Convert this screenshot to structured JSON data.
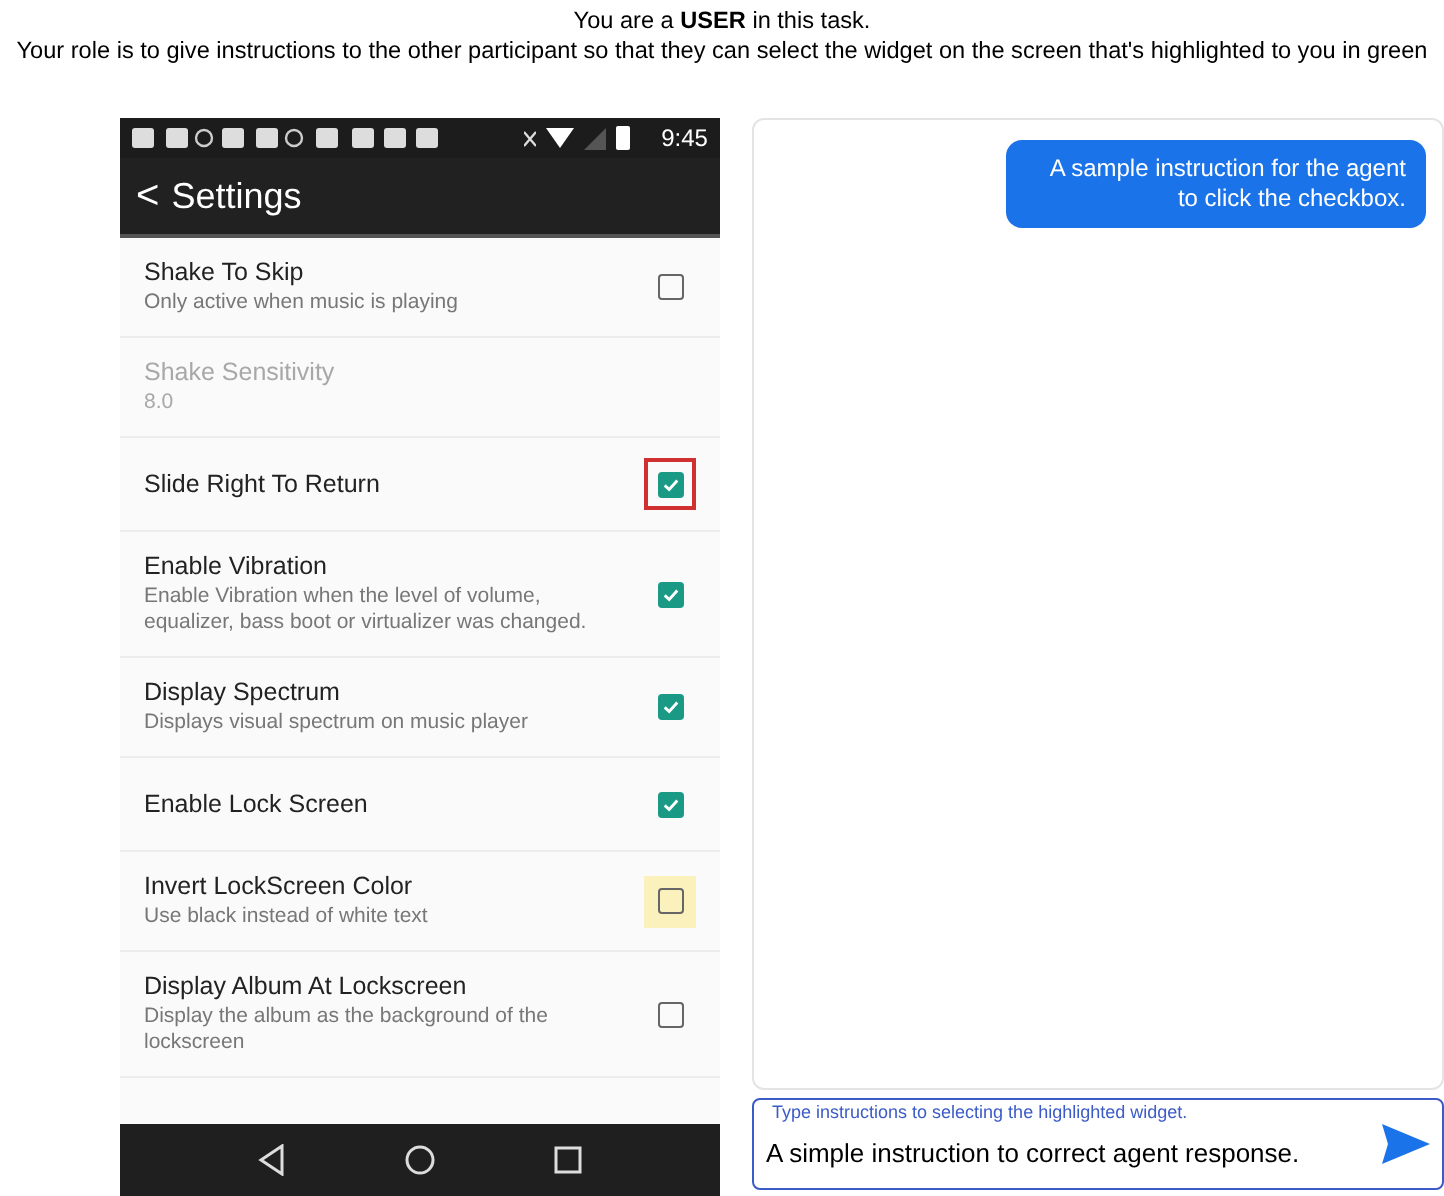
{
  "header": {
    "line1": "You are a **USER** in this task.",
    "line2": "Your role is to give instructions to the other participant so that they can select the widget on the screen that's highlighted to you in green"
  },
  "phone": {
    "time": "9:45",
    "app_bar": {
      "back": "<",
      "title": "Settings"
    },
    "settings": [
      {
        "kind": "checkbox",
        "title": "Shake To Skip",
        "subtitle": "Only active when music is playing",
        "checked": false,
        "disabled": false,
        "outlined": false,
        "highlighted": false
      },
      {
        "kind": "value",
        "title": "Shake Sensitivity",
        "subtitle": "8.0",
        "disabled": true
      },
      {
        "kind": "checkbox",
        "title": "Slide Right To Return",
        "checked": true,
        "disabled": false,
        "outlined": true,
        "highlighted": false
      },
      {
        "kind": "checkbox",
        "title": "Enable Vibration",
        "subtitle": "Enable Vibration when the level of volume, equalizer, bass boot or virtualizer was changed.",
        "checked": true,
        "disabled": false,
        "outlined": false,
        "highlighted": false
      },
      {
        "kind": "checkbox",
        "title": "Display Spectrum",
        "subtitle": "Displays visual spectrum on music player",
        "checked": true,
        "disabled": false,
        "outlined": false,
        "highlighted": false
      },
      {
        "kind": "checkbox",
        "title": "Enable Lock Screen",
        "checked": true,
        "disabled": false,
        "outlined": false,
        "highlighted": false
      },
      {
        "kind": "checkbox",
        "title": "Invert LockScreen Color",
        "subtitle": "Use black instead of white text",
        "checked": false,
        "disabled": false,
        "outlined": false,
        "highlighted": true
      },
      {
        "kind": "checkbox",
        "title": "Display Album At Lockscreen",
        "subtitle": "Display the album as the background of the lockscreen",
        "checked": false,
        "disabled": false,
        "outlined": false,
        "highlighted": false
      }
    ]
  },
  "chat": {
    "messages": [
      {
        "text": "A sample instruction for the agent to click the checkbox."
      }
    ],
    "input": {
      "label": "Type instructions to selecting the highlighted widget.",
      "value": "A simple instruction to correct agent response."
    }
  }
}
